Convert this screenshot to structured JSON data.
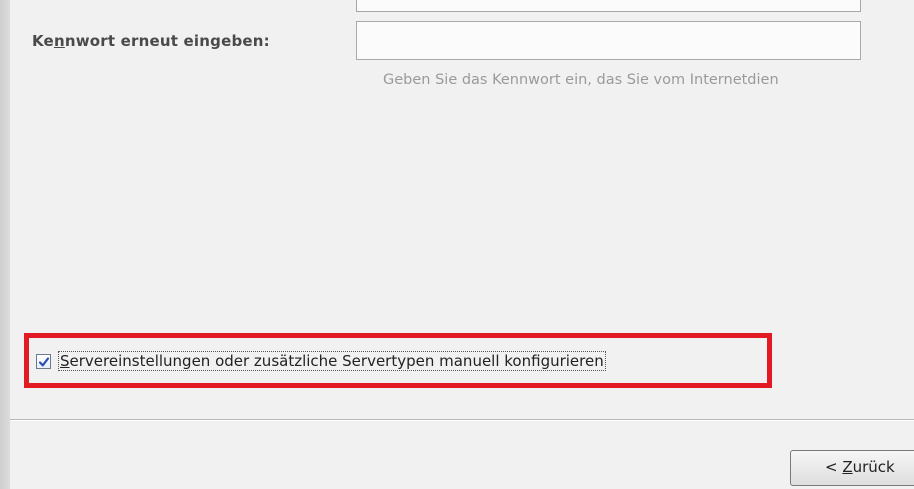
{
  "form": {
    "retype_label_pre": "Ke",
    "retype_label_accel": "n",
    "retype_label_post": "nwort erneut eingeben:",
    "retype_value": "",
    "hint": "Geben Sie das Kennwort ein, das Sie vom Internetdien"
  },
  "manual_config": {
    "checked": true,
    "label_accel": "S",
    "label_rest": "ervereinstellungen oder zusätzliche Servertypen manuell konfigurieren",
    "highlight_color": "#e21a24"
  },
  "footer": {
    "back_prefix": "< ",
    "back_accel": "Z",
    "back_rest": "urück"
  }
}
